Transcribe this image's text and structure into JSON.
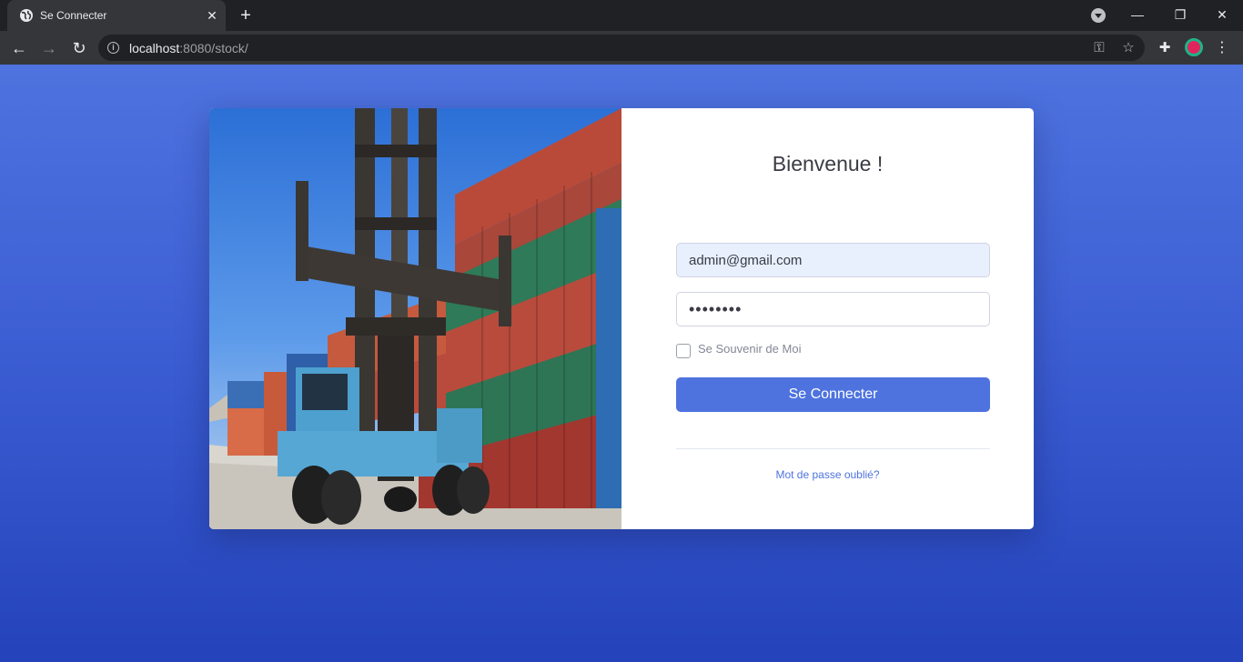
{
  "browser": {
    "tab_title": "Se Connecter",
    "url_host": "localhost",
    "url_path": ":8080/stock/",
    "icons": [
      "globe-icon",
      "close-icon",
      "plus-icon",
      "back-icon",
      "forward-icon",
      "reload-icon",
      "info-icon",
      "key-icon",
      "star-icon",
      "puzzle-icon",
      "profile-avatar",
      "more-vert-icon",
      "minimize-icon",
      "restore-icon"
    ]
  },
  "login": {
    "title": "Bienvenue !",
    "email_value": "admin@gmail.com",
    "password_value": "••••••••",
    "remember_label": "Se Souvenir de Moi",
    "remember_checked": false,
    "submit_label": "Se Connecter",
    "forgot_label": "Mot de passe oublié?"
  },
  "colors": {
    "primary": "#4e73df",
    "background_top": "#4e73df",
    "background_bottom": "#2443bb",
    "text_dark": "#3a3b45",
    "text_muted": "#858796",
    "autofill_bg": "#e8f0fe"
  }
}
